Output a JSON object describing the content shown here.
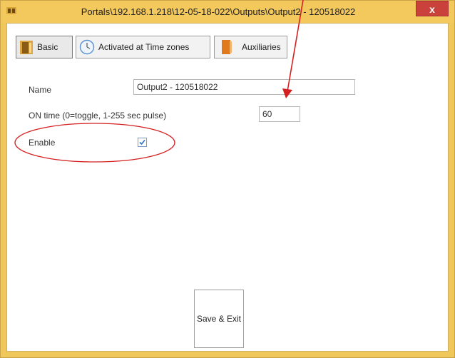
{
  "window": {
    "title": "Portals\\192.168.1.218\\12-05-18-022\\Outputs\\Output2 - 120518022",
    "close_label": "x"
  },
  "tabs": [
    {
      "label": "Basic",
      "icon": "door-icon"
    },
    {
      "label": "Activated at Time zones",
      "icon": "clock-icon"
    },
    {
      "label": "Auxiliaries",
      "icon": "door-icon"
    }
  ],
  "form": {
    "name_label": "Name",
    "name_value": "Output2 - 120518022",
    "on_time_label": "ON time (0=toggle, 1-255 sec pulse)",
    "on_time_value": "60",
    "enable_label": "Enable",
    "enable_checked": true
  },
  "buttons": {
    "save_exit": "Save & Exit"
  },
  "annotations": {
    "arrow_color": "#d42020",
    "ellipse_color": "#d42020"
  }
}
